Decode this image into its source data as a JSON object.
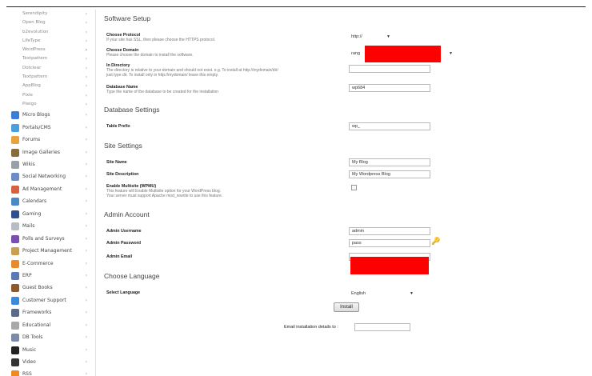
{
  "sidebar": {
    "sub_items": [
      {
        "label": "Serendipity"
      },
      {
        "label": "Open Blog"
      },
      {
        "label": "b2evolution"
      },
      {
        "label": "LifeType"
      },
      {
        "label": "WordPress",
        "active": true
      },
      {
        "label": "Textpattern"
      },
      {
        "label": "Dotclear"
      },
      {
        "label": "Textpattern"
      },
      {
        "label": "AppBlog"
      },
      {
        "label": "Pixie"
      },
      {
        "label": "Piwigo"
      }
    ],
    "categories": [
      {
        "label": "Micro Blogs",
        "icon": "micro-blogs-icon",
        "color": "#3b7dd8"
      },
      {
        "label": "Portals/CMS",
        "icon": "portals-cms-icon",
        "color": "#4aa0d8"
      },
      {
        "label": "Forums",
        "icon": "forums-icon",
        "color": "#e8a33b"
      },
      {
        "label": "Image Galleries",
        "icon": "image-galleries-icon",
        "color": "#8a6b3c"
      },
      {
        "label": "Wikis",
        "icon": "wikis-icon",
        "color": "#9aa0a8"
      },
      {
        "label": "Social Networking",
        "icon": "social-networking-icon",
        "color": "#6b8cc7"
      },
      {
        "label": "Ad Management",
        "icon": "ad-management-icon",
        "color": "#d86040"
      },
      {
        "label": "Calendars",
        "icon": "calendars-icon",
        "color": "#4a88c8"
      },
      {
        "label": "Gaming",
        "icon": "gaming-icon",
        "color": "#2f4f8f"
      },
      {
        "label": "Mails",
        "icon": "mails-icon",
        "color": "#b8bcc4"
      },
      {
        "label": "Polls and Surveys",
        "icon": "polls-surveys-icon",
        "color": "#7a4fb0"
      },
      {
        "label": "Project Management",
        "icon": "project-management-icon",
        "color": "#c8a050"
      },
      {
        "label": "E-Commerce",
        "icon": "e-commerce-icon",
        "color": "#e88a2a"
      },
      {
        "label": "ERP",
        "icon": "erp-icon",
        "color": "#5a7ab8"
      },
      {
        "label": "Guest Books",
        "icon": "guest-books-icon",
        "color": "#8a5a2a"
      },
      {
        "label": "Customer Support",
        "icon": "customer-support-icon",
        "color": "#3a8ad8"
      },
      {
        "label": "Frameworks",
        "icon": "frameworks-icon",
        "color": "#5a6a8a"
      },
      {
        "label": "Educational",
        "icon": "educational-icon",
        "color": "#a8a8a8"
      },
      {
        "label": "DB Tools",
        "icon": "db-tools-icon",
        "color": "#7a8aa8"
      },
      {
        "label": "Music",
        "icon": "music-icon",
        "color": "#222222"
      },
      {
        "label": "Video",
        "icon": "video-icon",
        "color": "#333333"
      },
      {
        "label": "RSS",
        "icon": "rss-icon",
        "color": "#f08a20"
      }
    ]
  },
  "main": {
    "software_setup": {
      "title": "Software Setup",
      "protocol_label": "Choose Protocol",
      "protocol_desc": "If your site has SSL, then please choose the HTTPS protocol.",
      "protocol_value": "http://",
      "domain_label": "Choose Domain",
      "domain_desc": "Please choose the domain to install the software.",
      "domain_value": "rang",
      "directory_label": "In Directory",
      "directory_desc1": "The directory is relative to your domain and should not exist. e.g. To install at http://mydomain/dir/",
      "directory_desc2": "just type dir. To install only in http://mydomain/ leave this empty.",
      "directory_value": "",
      "dbname_label": "Database Name",
      "dbname_desc": "Type the name of the database to be created for the installation",
      "dbname_value": "wp684"
    },
    "database_settings": {
      "title": "Database Settings",
      "prefix_label": "Table Prefix",
      "prefix_value": "wp_"
    },
    "site_settings": {
      "title": "Site Settings",
      "site_name_label": "Site Name",
      "site_name_value": "My Blog",
      "site_desc_label": "Site Description",
      "site_desc_value": "My Wordpress Blog",
      "multisite_label": "Enable Multisite (WPMU)",
      "multisite_desc1": "This feature will Enable Multisite option for your WordPress blog.",
      "multisite_desc2": "Your server must support Apache mod_rewrite to use this feature."
    },
    "admin_account": {
      "title": "Admin Account",
      "username_label": "Admin Username",
      "username_value": "admin",
      "password_label": "Admin Password",
      "password_value": "pass",
      "email_label": "Admin Email",
      "email_value": ""
    },
    "language": {
      "title": "Choose Language",
      "select_label": "Select Language",
      "select_value": "English"
    },
    "install_label": "Install",
    "email_details_label": "Email installation details to :",
    "email_details_value": ""
  },
  "colors": {
    "redaction": "#ff0000",
    "active_chevron": "#3366cc"
  }
}
